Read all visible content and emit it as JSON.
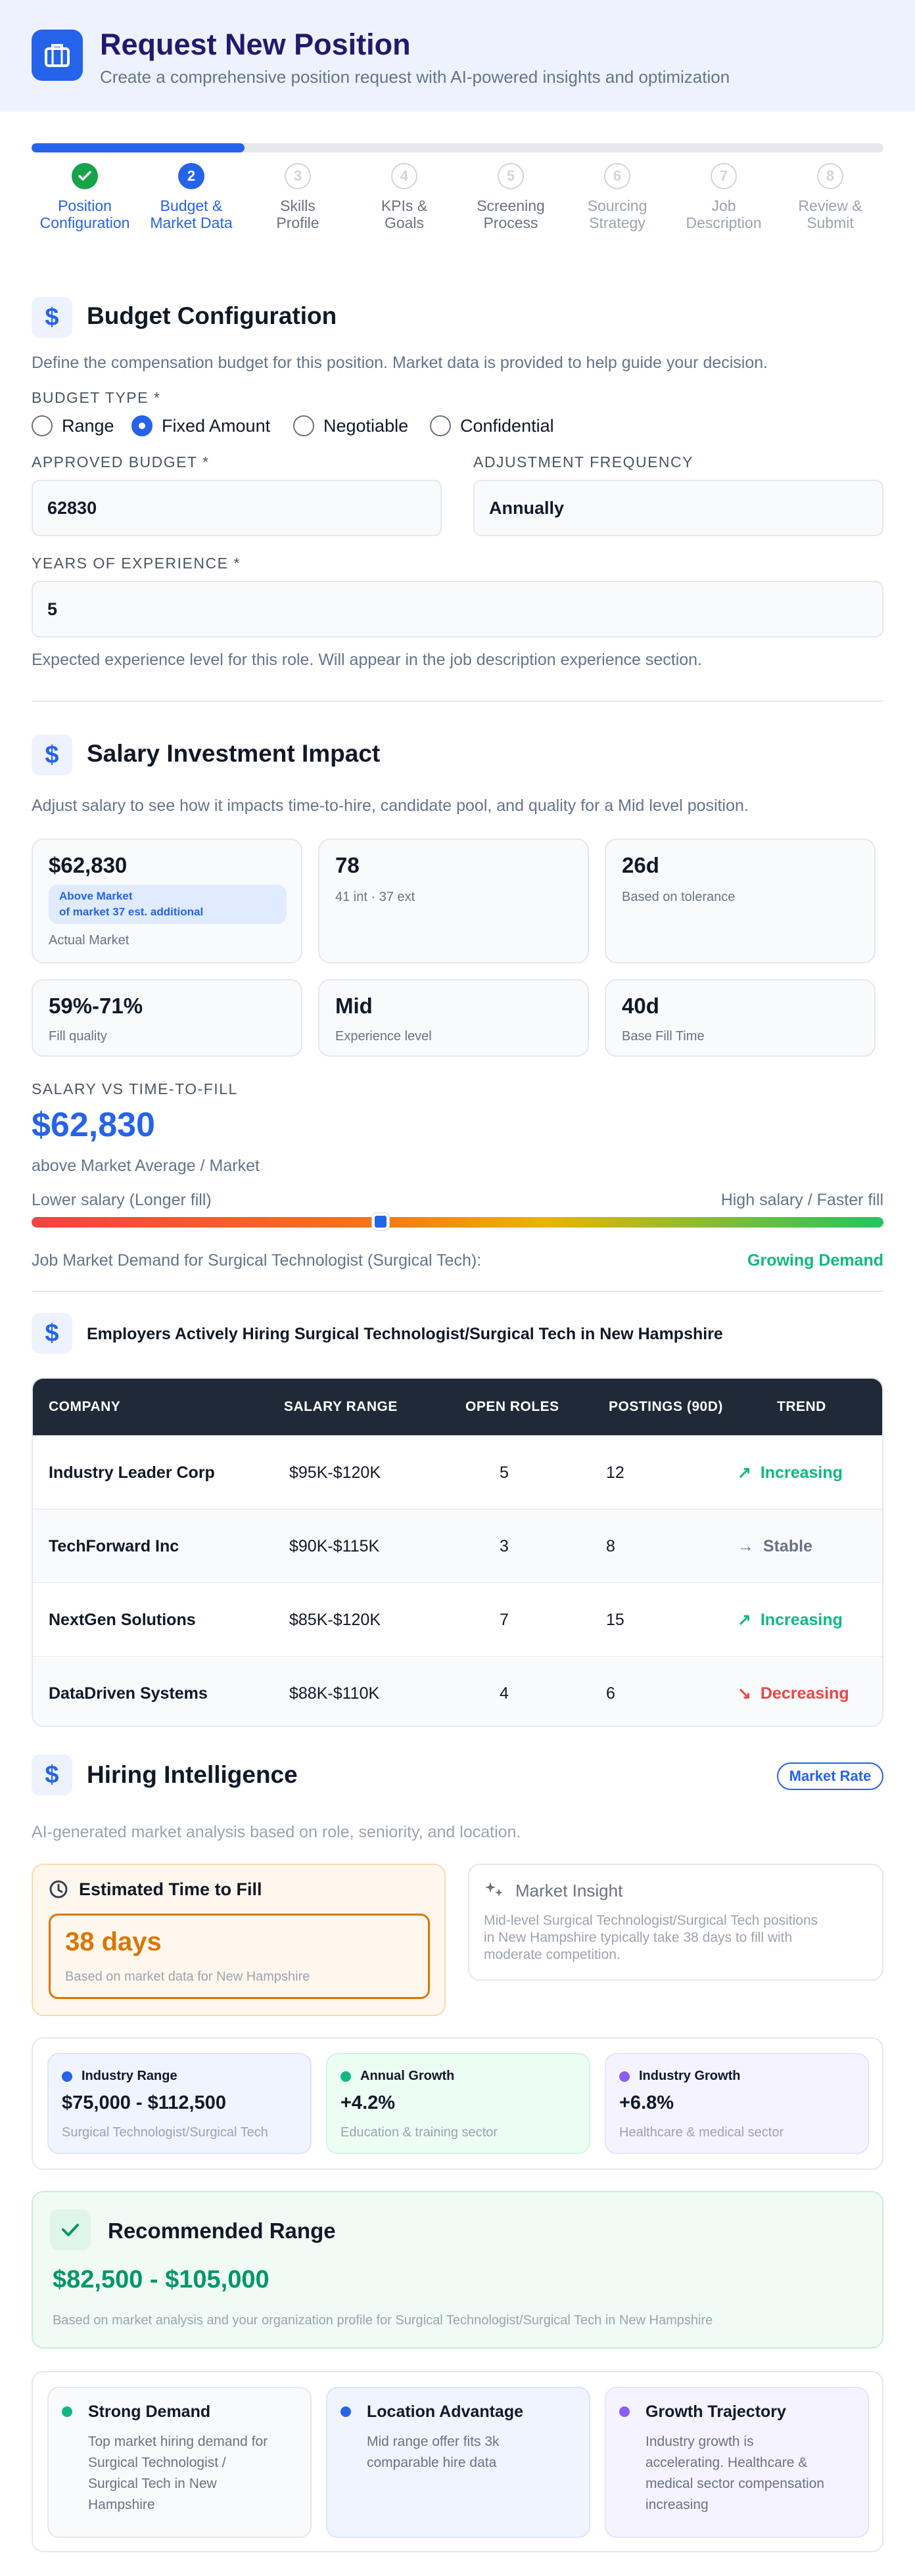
{
  "header": {
    "title": "Request New Position",
    "subtitle": "Create a comprehensive position request with AI-powered insights and optimization",
    "icon": "briefcase-icon"
  },
  "progress": {
    "completed_fraction": 0.25
  },
  "steps": [
    {
      "number": "",
      "line1": "Position",
      "line2": "Configuration",
      "state": "done"
    },
    {
      "number": "2",
      "line1": "Budget &",
      "line2": "Market Data",
      "state": "active"
    },
    {
      "number": "3",
      "line1": "Skills",
      "line2": "Profile",
      "state": "next"
    },
    {
      "number": "4",
      "line1": "KPIs &",
      "line2": "Goals",
      "state": "next"
    },
    {
      "number": "5",
      "line1": "Screening",
      "line2": "Process",
      "state": "next"
    },
    {
      "number": "6",
      "line1": "Sourcing",
      "line2": "Strategy",
      "state": "future"
    },
    {
      "number": "7",
      "line1": "Job",
      "line2": "Description",
      "state": "future"
    },
    {
      "number": "8",
      "line1": "Review &",
      "line2": "Submit",
      "state": "future"
    }
  ],
  "budget": {
    "title": "Budget Configuration",
    "description": "Define the compensation budget for this position. Market data is provided to help guide your decision.",
    "type_label": "BUDGET TYPE *",
    "options": [
      "Range",
      "Fixed Amount",
      "Negotiable",
      "Confidential"
    ],
    "selected": "Fixed Amount",
    "approved_label": "APPROVED BUDGET *",
    "approved_value": "62830",
    "frequency_label": "ADJUSTMENT FREQUENCY",
    "frequency_value": "Annually",
    "experience_label": "YEARS OF EXPERIENCE *",
    "experience_value": "5",
    "experience_help": "Expected experience level for this role. Will appear in the job description experience section."
  },
  "impact": {
    "title": "Salary Investment Impact",
    "description": "Adjust salary to see how it impacts time-to-hire, candidate pool, and quality for a Mid level position.",
    "cards": [
      {
        "value": "$62,830",
        "badge_line1": "Above Market",
        "badge_line2": "of market 37 est. additional",
        "sub": "Actual Market"
      },
      {
        "value": "78",
        "sub": "41 int · 37 ext"
      },
      {
        "value": "26d",
        "sub": "Based on tolerance"
      },
      {
        "value": "59%-71%",
        "sub": "Fill quality"
      },
      {
        "value": "Mid",
        "sub": "Experience level"
      },
      {
        "value": "40d",
        "sub": "Base Fill Time"
      }
    ],
    "slider_label": "SALARY VS TIME-TO-FILL",
    "salary": "$62,830",
    "salary_note": "above Market Average / Market",
    "low_label": "Lower salary (Longer fill)",
    "high_label": "High salary / Faster fill",
    "slider_position": 0.41,
    "demand_label": "Job Market Demand for Surgical Technologist (Surgical Tech):",
    "demand_value": "Growing Demand"
  },
  "employers": {
    "title": "Employers Actively Hiring Surgical Technologist/Surgical Tech in New Hampshire",
    "headers": [
      "COMPANY",
      "SALARY RANGE",
      "OPEN ROLES",
      "POSTINGS (90D)",
      "TREND"
    ],
    "rows": [
      {
        "company": "Industry Leader Corp",
        "salary": "$95K-$120K",
        "open": "5",
        "postings": "12",
        "trend": "Increasing",
        "arrow": "↗",
        "color": "#10b981"
      },
      {
        "company": "TechForward Inc",
        "salary": "$90K-$115K",
        "open": "3",
        "postings": "8",
        "trend": "Stable",
        "arrow": "→",
        "color": "#6b7280"
      },
      {
        "company": "NextGen Solutions",
        "salary": "$85K-$120K",
        "open": "7",
        "postings": "15",
        "trend": "Increasing",
        "arrow": "↗",
        "color": "#10b981"
      },
      {
        "company": "DataDriven Systems",
        "salary": "$88K-$110K",
        "open": "4",
        "postings": "6",
        "trend": "Decreasing",
        "arrow": "↘",
        "color": "#ef4444"
      }
    ]
  },
  "intel": {
    "title": "Hiring Intelligence",
    "pill": "Market Rate",
    "description": "AI-generated market analysis based on role, seniority, and location.",
    "ttf_title": "Estimated Time to Fill",
    "ttf_value": "38 days",
    "ttf_note": "Based on market data for New Hampshire",
    "insight_title": "Market Insight",
    "insight_text_1": "Mid-level Surgical Technologist/Surgical Tech positions",
    "insight_text_2": "in New Hampshire typically take 38 days to fill with",
    "insight_text_3": "moderate competition.",
    "stats": [
      {
        "label": "Industry Range",
        "value": "$75,000 - $112,500",
        "sub": "Surgical Technologist/Surgical Tech",
        "dot": "#2563eb"
      },
      {
        "label": "Annual Growth",
        "value": "+4.2%",
        "sub": "Education & training sector",
        "dot": "#10b981"
      },
      {
        "label": "Industry Growth",
        "value": "+6.8%",
        "sub": "Healthcare & medical sector",
        "dot": "#8b5cf6"
      }
    ],
    "rec_title": "Recommended Range",
    "rec_value": "$82,500 - $105,000",
    "rec_note": "Based on market analysis and your organization profile for Surgical Technologist/Surgical Tech in New Hampshire",
    "factors": [
      {
        "title": "Strong Demand",
        "lines": [
          "Top market hiring demand for",
          "Surgical Technologist /",
          "Surgical Tech in New",
          "Hampshire"
        ],
        "dot": "#10b981"
      },
      {
        "title": "Location Advantage",
        "lines": [
          "Mid range offer fits 3k",
          "comparable hire data"
        ],
        "dot": "#2563eb"
      },
      {
        "title": "Growth Trajectory",
        "lines": [
          "Industry growth is",
          "accelerating. Healthcare &",
          "medical sector compensation",
          "increasing"
        ],
        "dot": "#8b5cf6"
      }
    ]
  },
  "colors": {
    "accent": "#2563eb",
    "success": "#10b981",
    "danger": "#ef4444",
    "warning": "#d97706"
  }
}
